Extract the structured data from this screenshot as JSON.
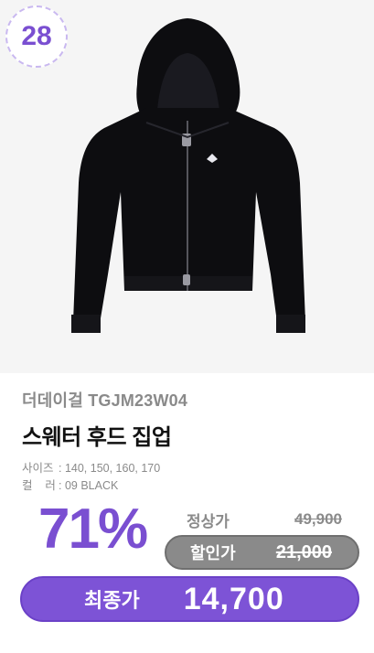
{
  "badge": {
    "number": "28"
  },
  "product": {
    "brand_line": "더데이걸 TGJM23W04",
    "name": "스웨터 후드 집업",
    "specs": [
      {
        "key": "사이즈",
        "value": ": 140, 150, 160, 170"
      },
      {
        "key": "컬    러",
        "value": ": 09 BLACK"
      }
    ]
  },
  "pricing": {
    "discount_percent": "71%",
    "regular_label": "정상가",
    "regular_price": "49,900",
    "sale_label": "할인가",
    "sale_price": "21,000",
    "final_label": "최종가",
    "final_price": "14,700"
  },
  "colors": {
    "accent_purple": "#7d53d6",
    "gray_pill": "#8a8a8a",
    "garment": "#0d0d10"
  },
  "icons": {
    "product_image": "black-zip-hoodie-image"
  }
}
